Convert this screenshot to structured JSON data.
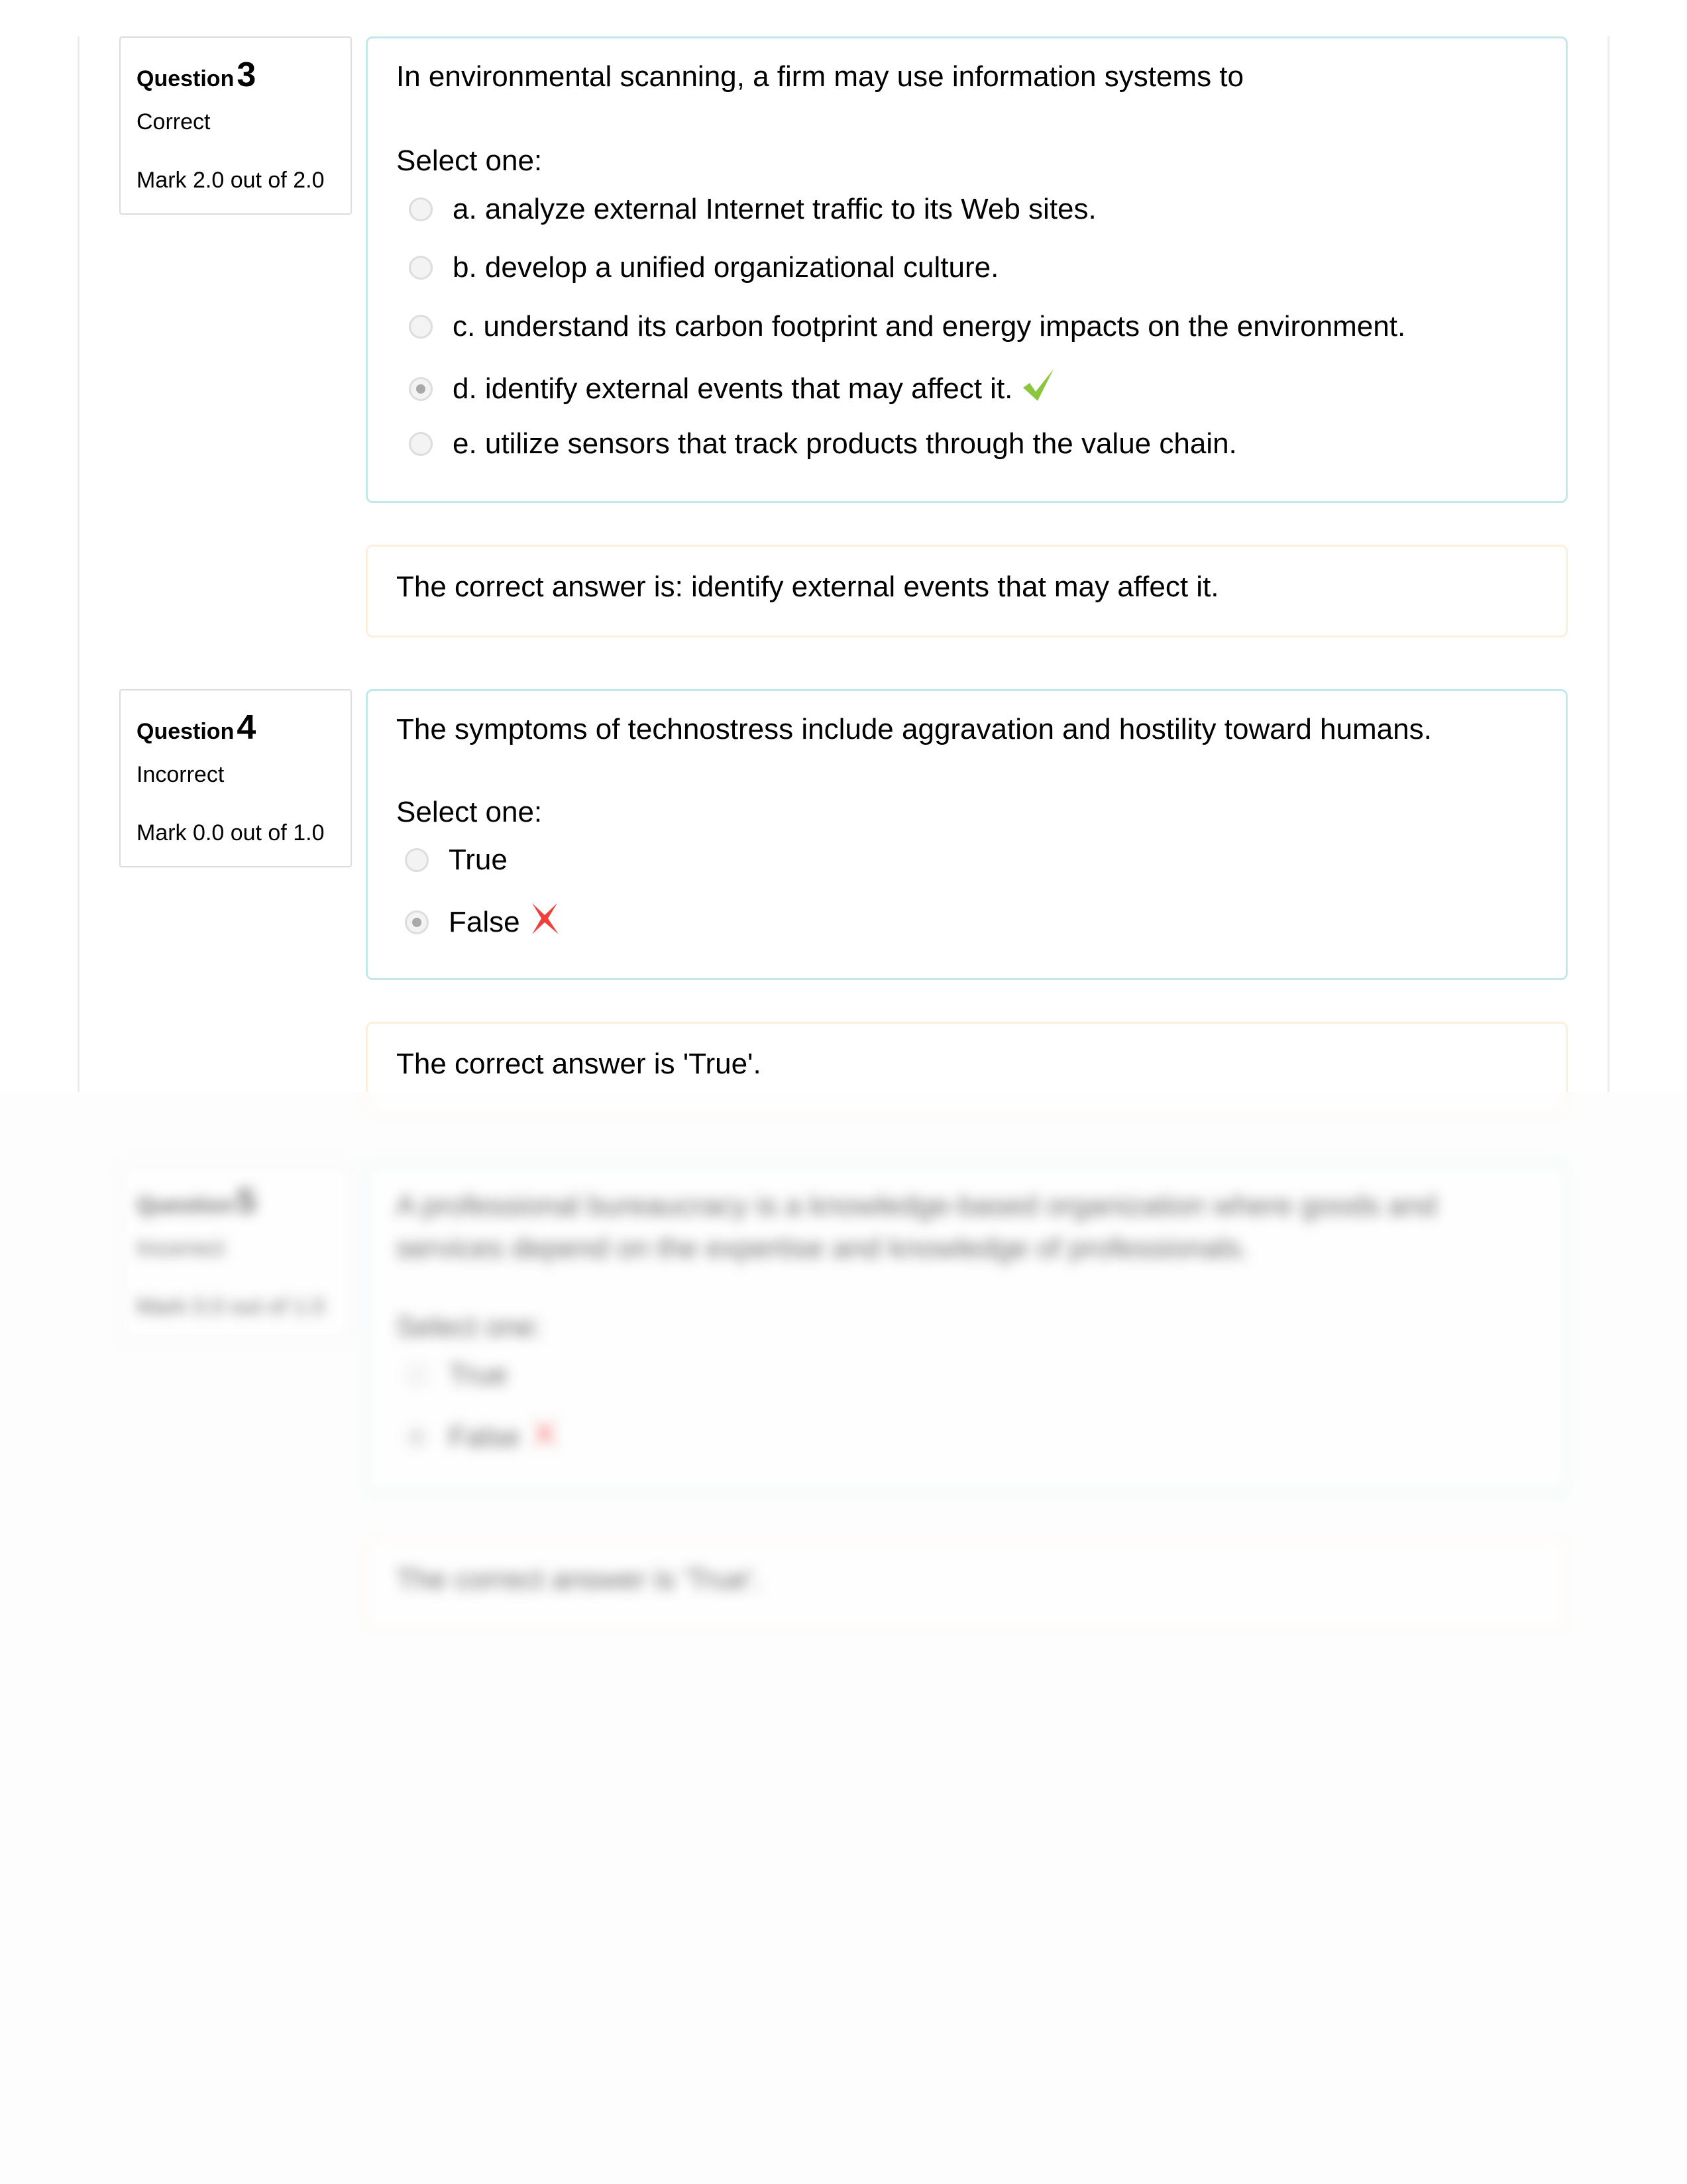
{
  "questions": [
    {
      "label": "Question",
      "number": "3",
      "state": "Correct",
      "grade": "Mark 2.0 out of 2.0",
      "text": "In environmental scanning, a firm may use information systems to",
      "prompt": "Select one:",
      "options": [
        {
          "label": "a. analyze external Internet traffic to its Web sites.",
          "checked": false
        },
        {
          "label": "b. develop a unified organizational culture.",
          "checked": false
        },
        {
          "label": "c. understand its carbon footprint and energy impacts on the environment.",
          "checked": false
        },
        {
          "label": "d. identify external events that may affect it.",
          "checked": true,
          "mark": "check-icon"
        },
        {
          "label": "e. utilize sensors that track products through the value chain.",
          "checked": false
        }
      ],
      "feedback": "The correct answer is: identify external events that may affect it."
    },
    {
      "label": "Question",
      "number": "4",
      "state": "Incorrect",
      "grade": "Mark 0.0 out of 1.0",
      "text": "The symptoms of technostress include aggravation and hostility toward humans.",
      "prompt": "Select one:",
      "options": [
        {
          "label": "True",
          "checked": false
        },
        {
          "label": "False",
          "checked": true,
          "mark": "cross-icon"
        }
      ],
      "feedback": "The correct answer is 'True'."
    },
    {
      "label": "Question",
      "number": "5",
      "state": "Incorrect",
      "grade": "Mark 0.0 out of 1.0",
      "text": "A professional bureaucracy is a knowledge-based organization where goods and services depend on the expertise and knowledge of professionals.",
      "prompt": "Select one:",
      "options": [
        {
          "label": "True",
          "checked": false
        },
        {
          "label": "False",
          "checked": true,
          "mark": "cross-icon"
        }
      ],
      "feedback": "The correct answer is 'True'."
    }
  ],
  "colors": {
    "content_border": "#c3e8ec",
    "feedback_border": "#fcf0dc",
    "correct_mark": "#8cc63f",
    "incorrect_mark": "#f0403c"
  }
}
